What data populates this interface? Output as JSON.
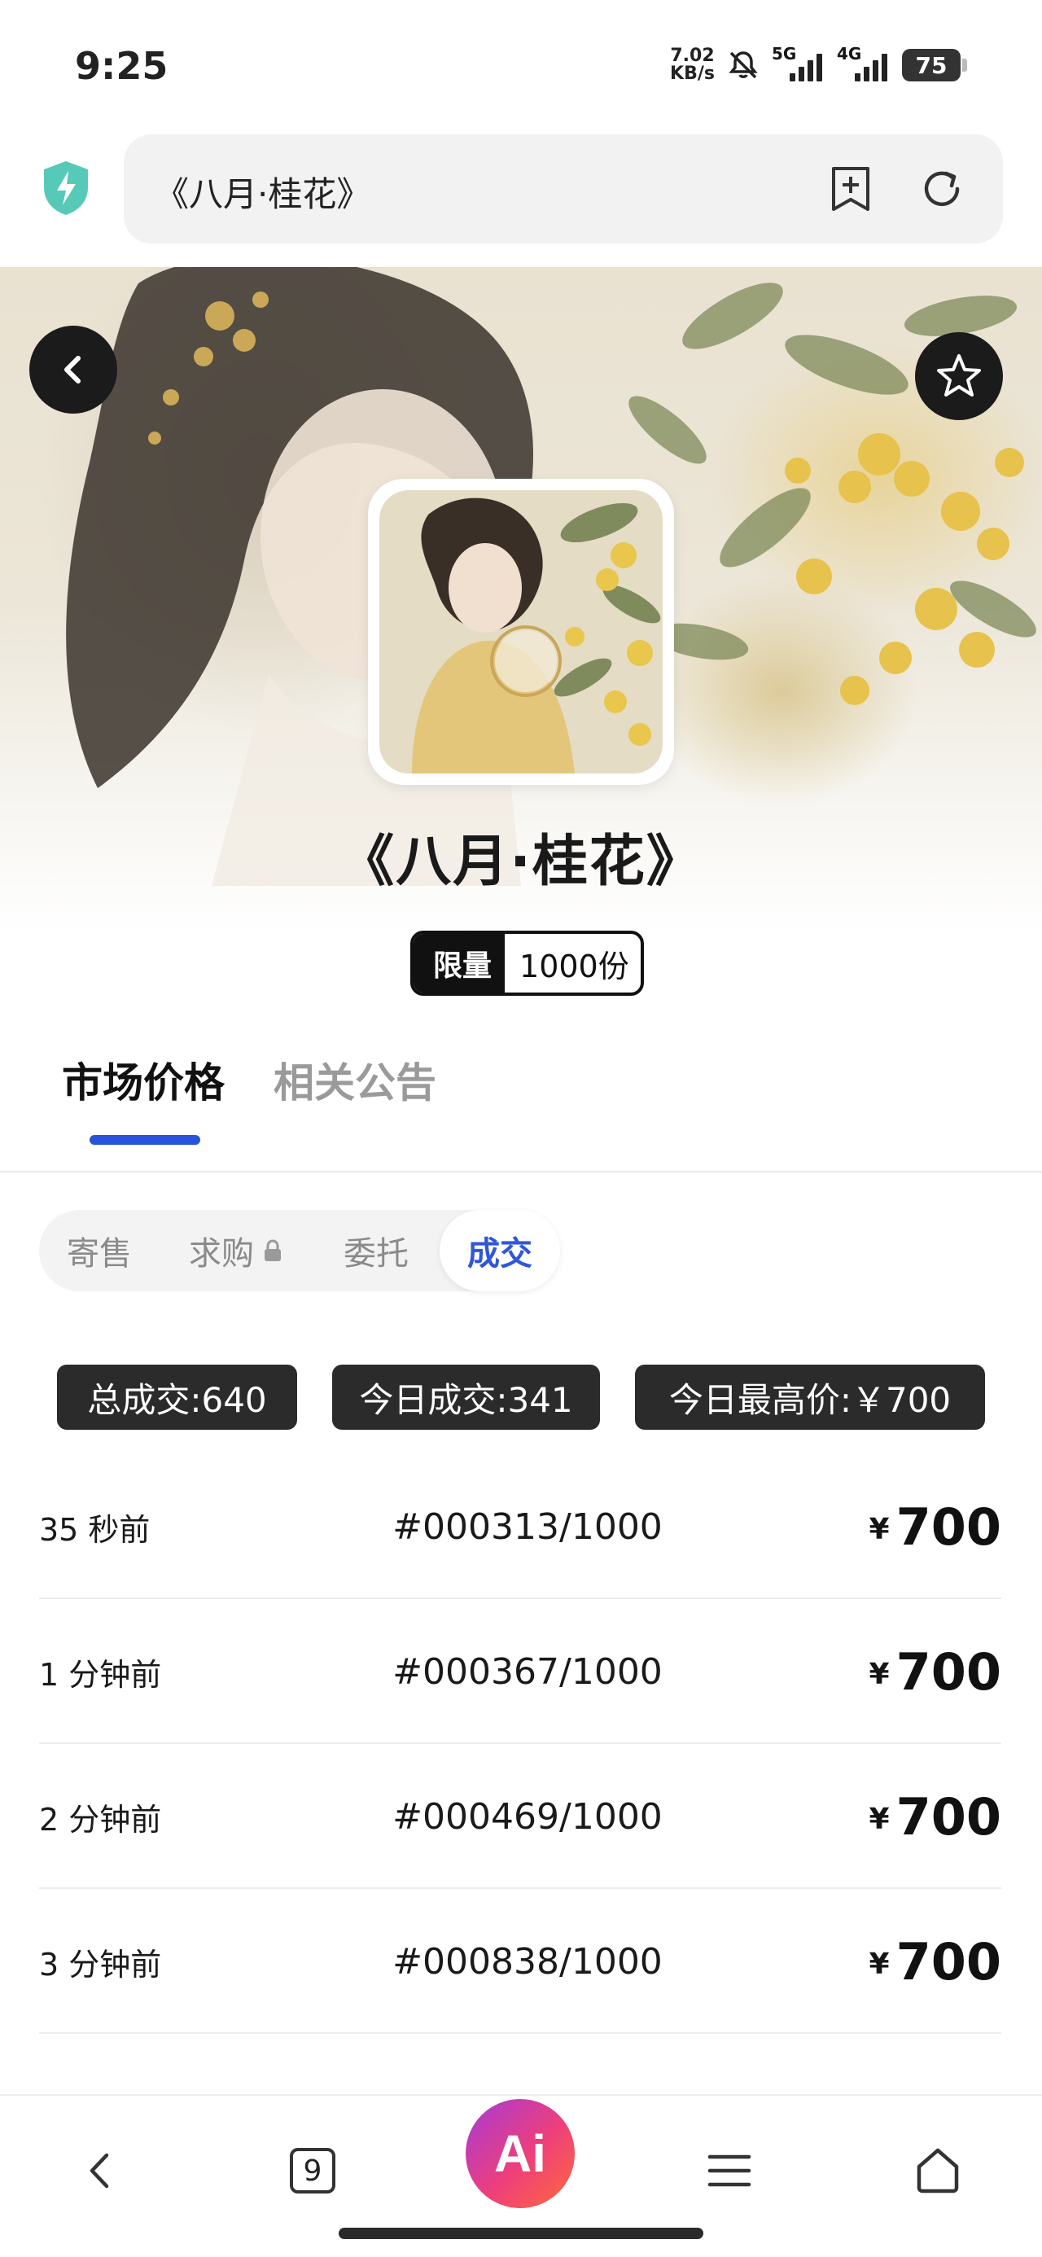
{
  "status_bar": {
    "time": "9:25",
    "net_speed_value": "7.02",
    "net_speed_unit": "KB/s",
    "signal_1": "5G",
    "signal_2": "4G",
    "battery": "75"
  },
  "address_bar": {
    "url_text": "《八月·桂花》"
  },
  "product": {
    "title": "《八月·桂花》",
    "limit_label": "限量",
    "limit_value": "1000份"
  },
  "tabs": [
    {
      "label": "市场价格",
      "active": true
    },
    {
      "label": "相关公告",
      "active": false
    }
  ],
  "segments": [
    {
      "label": "寄售",
      "active": false
    },
    {
      "label": "求购",
      "active": false,
      "locked": true
    },
    {
      "label": "委托",
      "active": false
    },
    {
      "label": "成交",
      "active": true
    }
  ],
  "stats": {
    "total": "总成交:640",
    "today": "今日成交:341",
    "today_high": "今日最高价:￥700"
  },
  "trades": [
    {
      "time": "35 秒前",
      "serial": "#000313/1000",
      "currency": "¥",
      "price": "700"
    },
    {
      "time": "1 分钟前",
      "serial": "#000367/1000",
      "currency": "¥",
      "price": "700"
    },
    {
      "time": "2 分钟前",
      "serial": "#000469/1000",
      "currency": "¥",
      "price": "700"
    },
    {
      "time": "3 分钟前",
      "serial": "#000838/1000",
      "currency": "¥",
      "price": "700"
    }
  ],
  "bottom_nav": {
    "tab_count": "9",
    "ai_label": "Ai"
  },
  "colors": {
    "accent_blue": "#2854d9",
    "dark_chip": "#2b2b2b",
    "ai_gradient_start": "#a63ad8",
    "ai_gradient_end": "#ff6a3a"
  },
  "icons": {
    "shield": "shield-lightning-icon",
    "bookmark_add": "bookmark-add-icon",
    "reload": "reload-icon",
    "back": "chevron-left-icon",
    "favorite": "star-icon",
    "lock": "lock-icon",
    "nav_back": "chevron-left-icon",
    "nav_menu": "menu-icon",
    "nav_home": "home-icon"
  }
}
